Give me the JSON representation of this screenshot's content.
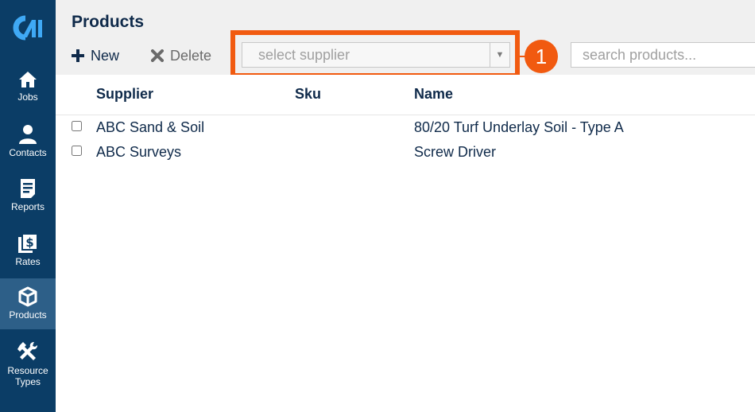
{
  "sidebar": {
    "items": [
      {
        "label": "Jobs",
        "icon": "home-icon"
      },
      {
        "label": "Contacts",
        "icon": "person-icon"
      },
      {
        "label": "Reports",
        "icon": "report-icon"
      },
      {
        "label": "Rates",
        "icon": "dollar-icon"
      },
      {
        "label": "Products",
        "icon": "box-icon"
      },
      {
        "label": "Resource\nTypes",
        "icon": "tools-icon"
      }
    ],
    "active": "Products"
  },
  "header": {
    "title": "Products",
    "new_label": "New",
    "delete_label": "Delete",
    "supplier_placeholder": "select supplier",
    "search_placeholder": "search products...",
    "step_number": "1"
  },
  "table": {
    "columns": [
      "Supplier",
      "Sku",
      "Name"
    ],
    "rows": [
      {
        "supplier": "ABC Sand & Soil",
        "sku": "",
        "name": "80/20 Turf Underlay Soil - Type A"
      },
      {
        "supplier": "ABC Surveys",
        "sku": "",
        "name": "Screw Driver"
      }
    ]
  },
  "colors": {
    "sidebar_bg": "#0b3d66",
    "sidebar_active": "#2d5f88",
    "accent_orange": "#f15a10",
    "text_navy": "#0f2a4a"
  }
}
